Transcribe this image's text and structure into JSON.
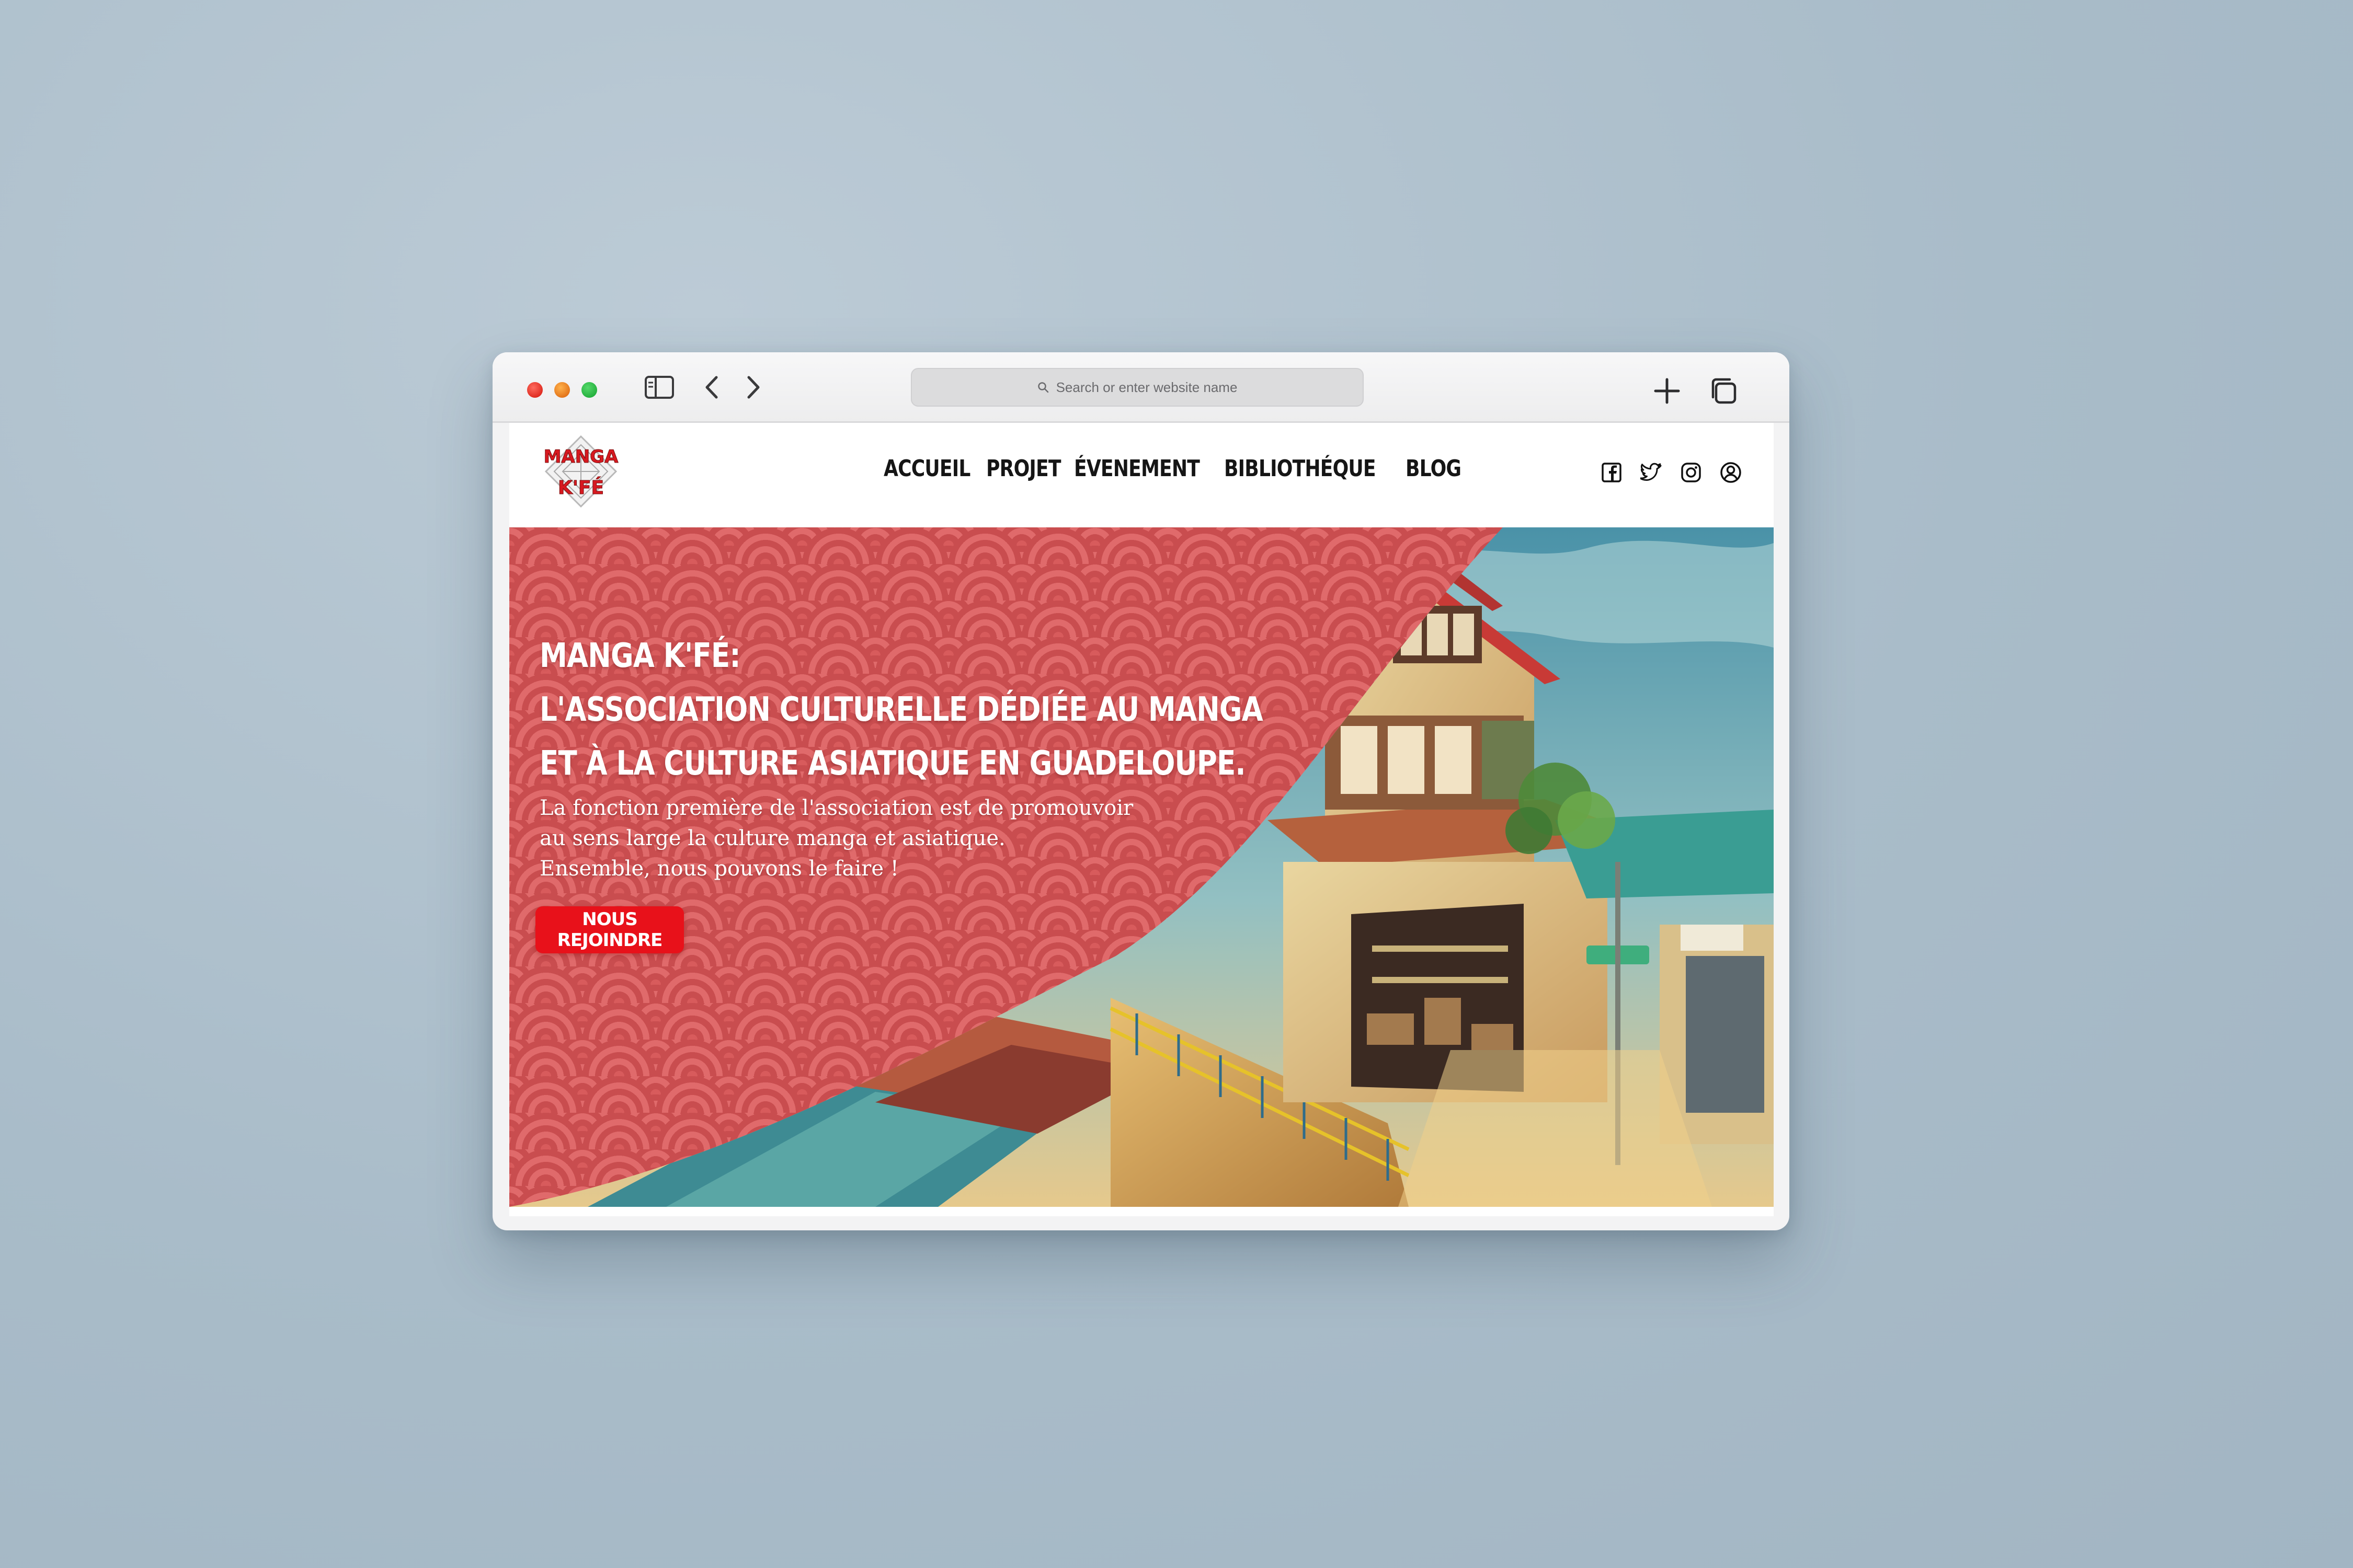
{
  "browser": {
    "address_placeholder": "Search or enter website name"
  },
  "nav": {
    "logo_text": "MANGA K'FÉ",
    "links": [
      "ACCUEIL",
      "PROJET",
      "ÉVENEMENT",
      "BIBLIOTHÉQUE",
      "BLOG"
    ],
    "social_icons": [
      "facebook-icon",
      "twitter-icon",
      "instagram-icon",
      "user-account-icon"
    ]
  },
  "hero": {
    "headline": [
      "MANGA K'FÉ:",
      "L'ASSOCIATION CULTURELLE DÉDIÉE AU MANGA",
      "ET À LA CULTURE ASIATIQUE EN GUADELOUPE."
    ],
    "description": [
      "La fonction première de l'association est de promouvoir",
      "au sens large la culture manga et asiatique.",
      "Ensemble, nous pouvons le faire !"
    ],
    "cta_label": "NOUS REJOINDRE"
  },
  "colors": {
    "pattern_red": "#d85b5c",
    "cta_red": "#e8111a",
    "background": "#a9bcc9"
  }
}
